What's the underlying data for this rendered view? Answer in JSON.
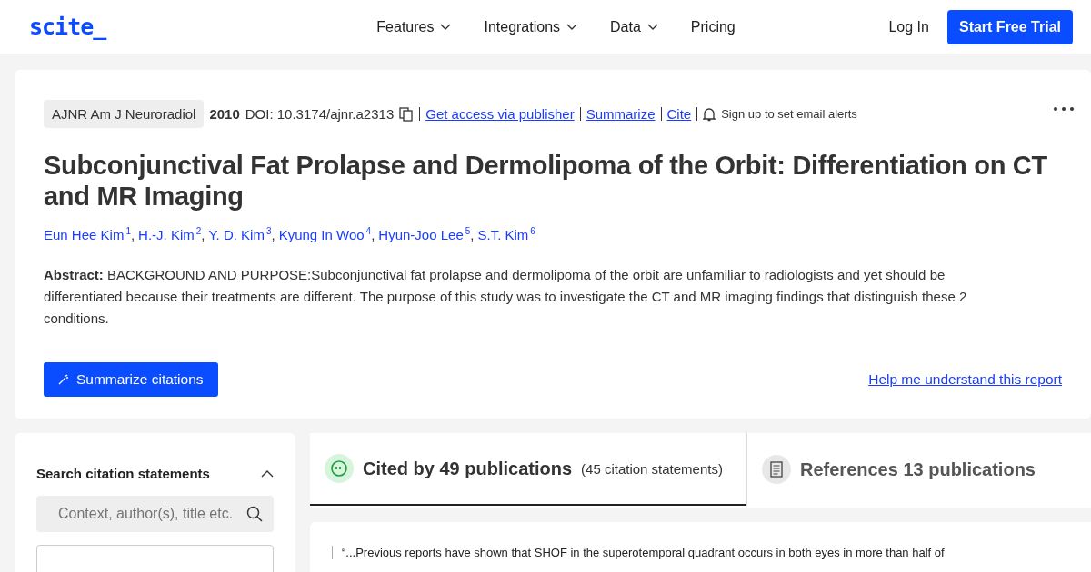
{
  "header": {
    "logo": "scite_",
    "nav": [
      {
        "label": "Features",
        "dropdown": true
      },
      {
        "label": "Integrations",
        "dropdown": true
      },
      {
        "label": "Data",
        "dropdown": true
      },
      {
        "label": "Pricing",
        "dropdown": false
      }
    ],
    "login": "Log In",
    "trial": "Start Free Trial"
  },
  "paper": {
    "journal": "AJNR Am J Neuroradiol",
    "year": "2010",
    "doi": "DOI: 10.3174/ajnr.a2313",
    "links": [
      "Get access via publisher",
      "Summarize",
      "Cite"
    ],
    "alerts": "Sign up to set email alerts",
    "title": "Subconjunctival Fat Prolapse and Dermolipoma of the Orbit: Differentiation on CT and MR Imaging",
    "author_separator": ",",
    "authors": [
      {
        "name": "Eun Hee Kim",
        "sup": "1"
      },
      {
        "name": "H.-J. Kim",
        "sup": "2"
      },
      {
        "name": "Y. D. Kim",
        "sup": "3"
      },
      {
        "name": "Kyung In Woo",
        "sup": "4"
      },
      {
        "name": "Hyun-Joo Lee",
        "sup": "5"
      },
      {
        "name": "S.T. Kim",
        "sup": "6"
      }
    ],
    "abstract": "**Abstract:** BACKGROUND AND PURPOSE:Subconjunctival fat prolapse and dermolipoma of the orbit are unfamiliar to radiologists and yet should be differentiated because their treatments are different. The purpose of this study was to investigate the CT and MR imaging findings that distinguish these 2 conditions.",
    "summarize_button": "Summarize citations",
    "help_link": "Help me understand this report"
  },
  "sidebar": {
    "title": "Search citation statements",
    "expanded": true,
    "search": {
      "placeholder": "Context, author(s), title etc."
    }
  },
  "tabs": [
    {
      "kind": "cited",
      "label": "Cited by 49 publications",
      "note": "(45 citation statements)",
      "selected": true
    },
    {
      "kind": "references",
      "label": "References 13 publications",
      "selected": false
    }
  ],
  "citation": {
    "quote": "“...Previous reports have shown that SHOF in the superotemporal quadrant occurs in both eyes in more than half of"
  }
}
